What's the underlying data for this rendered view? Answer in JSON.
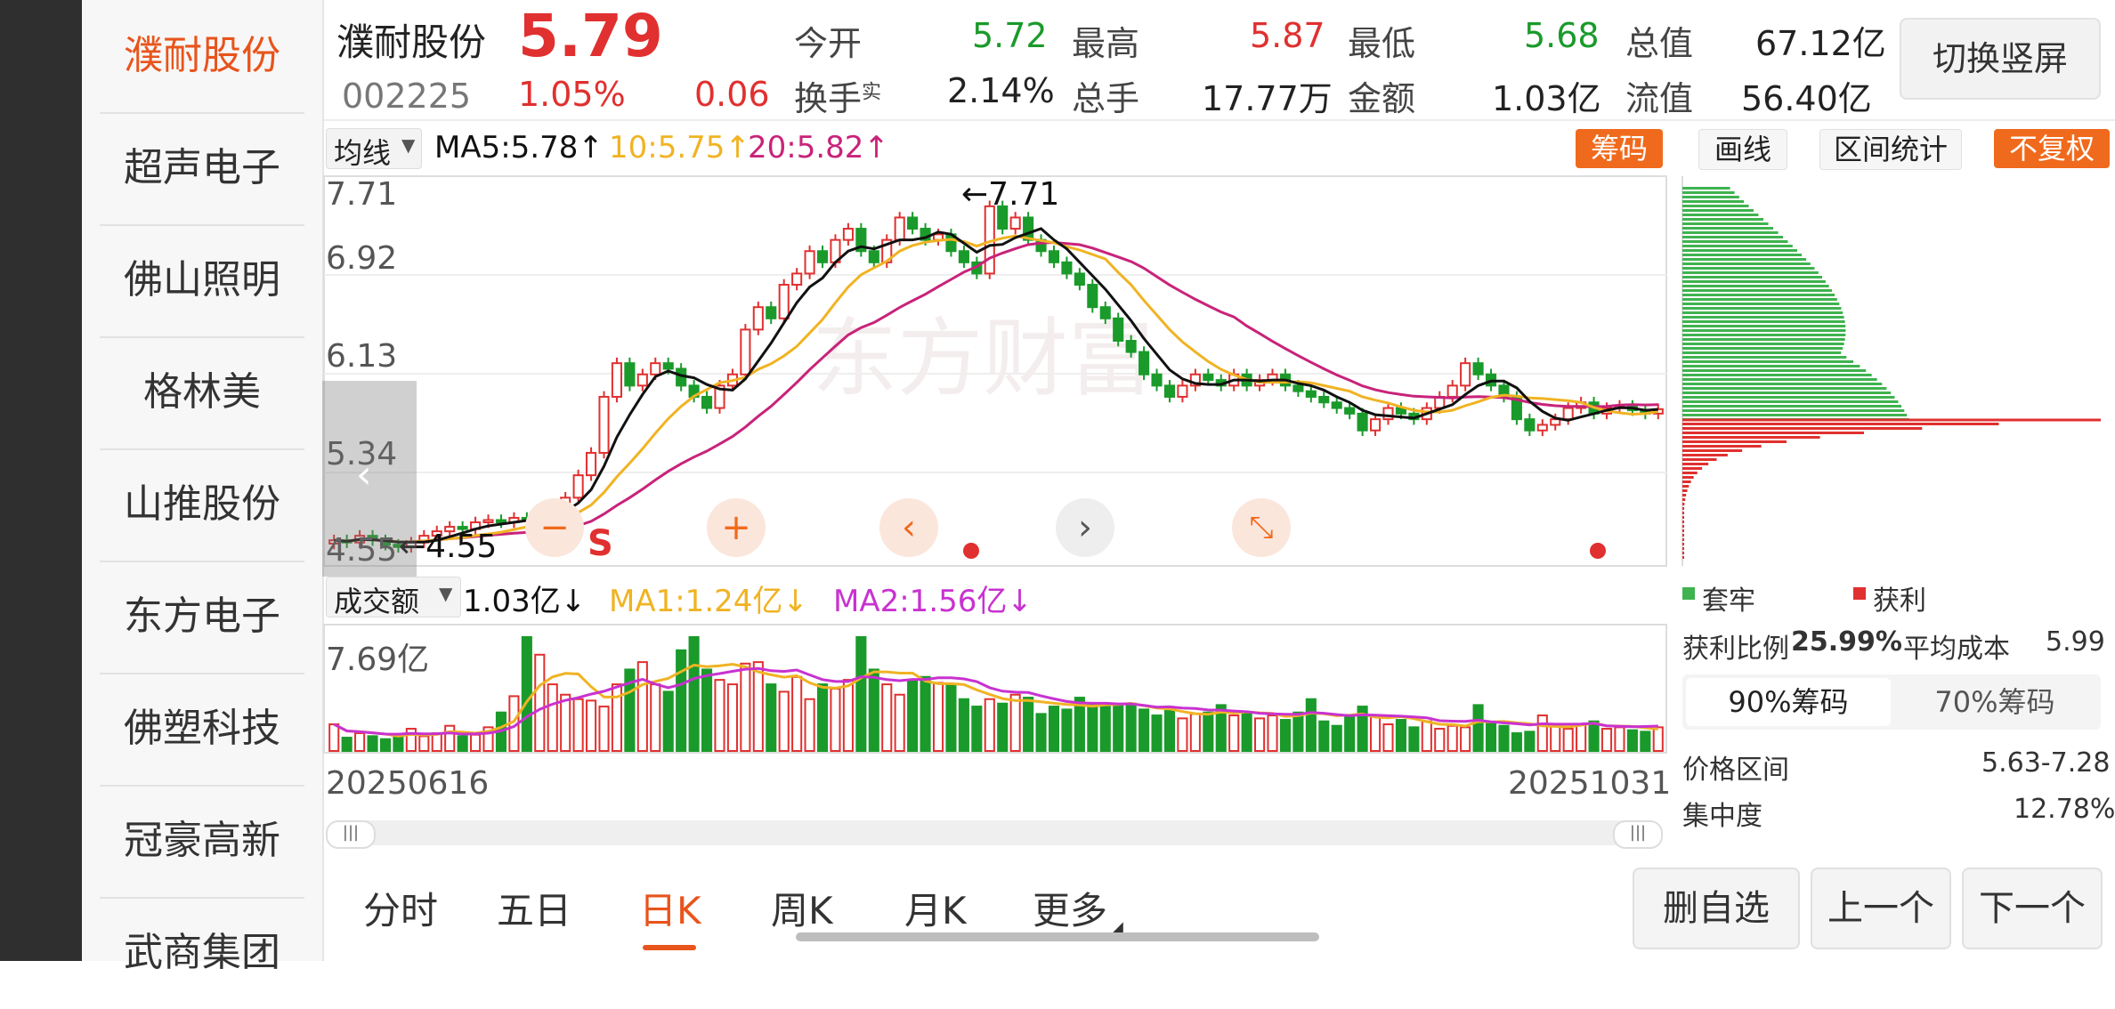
{
  "sidebar": {
    "items": [
      {
        "label": "濮耐股份",
        "active": true
      },
      {
        "label": "超声电子"
      },
      {
        "label": "佛山照明"
      },
      {
        "label": "格林美"
      },
      {
        "label": "山推股份"
      },
      {
        "label": "东方电子"
      },
      {
        "label": "佛塑科技"
      },
      {
        "label": "冠豪高新"
      },
      {
        "label": "武商集团"
      }
    ]
  },
  "quote": {
    "name": "濮耐股份",
    "price": "5.79",
    "code": "002225",
    "pct": "1.05%",
    "change": "0.06",
    "open_label": "今开",
    "open": "5.72",
    "high_label": "最高",
    "high": "5.87",
    "low_label": "最低",
    "low": "5.68",
    "mcap_label": "总值",
    "mcap": "67.12亿",
    "turnover_label": "换手",
    "turnover_sup": "实",
    "turnover": "2.14%",
    "volume_label": "总手",
    "volume": "17.77万",
    "amount_label": "金额",
    "amount": "1.03亿",
    "float_label": "流值",
    "float": "56.40亿",
    "switch_button": "切换竖屏"
  },
  "toolbar": {
    "indicator": "均线",
    "ma5": "MA5:5.78",
    "ma10": "10:5.75",
    "ma20": "20:5.82",
    "chip_button": "筹码",
    "draw_button": "画线",
    "range_button": "区间统计",
    "adjust_button": "不复权"
  },
  "colors": {
    "up": "#e0302f",
    "down": "#1a9a2a",
    "ma5": "#111111",
    "ma10": "#f0b323",
    "ma20": "#c8237a",
    "accent": "#f06a1d",
    "ma2": "#c832d0"
  },
  "chart_data": [
    {
      "type": "candlestick",
      "ylim": [
        4.55,
        7.71
      ],
      "y_ticks": [
        "7.71",
        "6.92",
        "6.13",
        "5.34",
        "4.55"
      ],
      "max_label": "7.71",
      "min_label": "4.55",
      "date_start": "20250616",
      "date_end": "20251031",
      "close": [
        4.62,
        4.6,
        4.66,
        4.62,
        4.58,
        4.56,
        4.6,
        4.66,
        4.7,
        4.74,
        4.72,
        4.78,
        4.8,
        4.78,
        4.82,
        4.8,
        4.86,
        4.9,
        5.0,
        5.2,
        5.4,
        5.9,
        6.2,
        6.0,
        6.1,
        6.2,
        6.15,
        6.0,
        5.9,
        5.8,
        6.0,
        6.1,
        6.5,
        6.7,
        6.6,
        6.9,
        7.0,
        7.2,
        7.1,
        7.3,
        7.4,
        7.2,
        7.1,
        7.3,
        7.5,
        7.4,
        7.3,
        7.35,
        7.2,
        7.1,
        7.0,
        7.6,
        7.4,
        7.5,
        7.3,
        7.2,
        7.1,
        7.0,
        6.9,
        6.7,
        6.6,
        6.4,
        6.3,
        6.1,
        6.0,
        5.9,
        6.0,
        6.1,
        6.05,
        6.0,
        6.1,
        6.0,
        6.05,
        6.1,
        6.0,
        5.95,
        5.9,
        5.85,
        5.8,
        5.75,
        5.6,
        5.7,
        5.8,
        5.75,
        5.7,
        5.8,
        5.9,
        6.0,
        6.2,
        6.1,
        6.0,
        5.9,
        5.7,
        5.6,
        5.65,
        5.7,
        5.8,
        5.85,
        5.75,
        5.8,
        5.82,
        5.78,
        5.75,
        5.79
      ]
    },
    {
      "type": "bar",
      "series_label": "成交额",
      "amount": "1.03亿",
      "ma1": "MA1:1.24亿",
      "ma2": "MA2:1.56亿",
      "y_max_label": "7.69亿",
      "values": [
        1.8,
        0.9,
        1.2,
        1.0,
        0.8,
        1.1,
        1.5,
        1.0,
        1.2,
        1.7,
        1.0,
        1.1,
        1.6,
        2.6,
        3.7,
        7.69,
        6.5,
        4.5,
        3.8,
        3.5,
        3.4,
        3.0,
        4.5,
        5.5,
        6.0,
        4.5,
        4.0,
        6.8,
        7.69,
        5.5,
        4.8,
        4.5,
        5.9,
        6.0,
        4.5,
        4.0,
        5.0,
        3.5,
        4.5,
        4.2,
        4.8,
        7.69,
        5.5,
        4.5,
        3.8,
        4.8,
        5.0,
        4.6,
        4.5,
        3.5,
        3.0,
        3.5,
        3.2,
        3.8,
        3.6,
        2.5,
        3.0,
        2.8,
        3.6,
        3.2,
        3.0,
        3.1,
        3.2,
        2.8,
        2.4,
        2.7,
        2.2,
        2.5,
        2.6,
        3.1,
        2.4,
        2.6,
        2.2,
        2.4,
        2.1,
        2.6,
        3.5,
        2.0,
        1.7,
        2.3,
        3.0,
        2.4,
        1.8,
        2.1,
        1.6,
        2.0,
        1.5,
        1.7,
        1.6,
        3.1,
        1.9,
        1.7,
        1.2,
        1.3,
        2.4,
        1.7,
        1.5,
        1.8,
        2.0,
        1.5,
        1.6,
        1.4,
        1.3,
        1.6
      ]
    }
  ],
  "chips": {
    "legend_trapped": "套牢",
    "legend_profit": "获利",
    "profit_ratio_label": "获利比例",
    "profit_ratio": "25.99%",
    "avg_cost_label": "平均成本",
    "avg_cost": "5.99",
    "tab_90": "90%筹码",
    "tab_70": "70%筹码",
    "range_label": "价格区间",
    "range": "5.63-7.28",
    "conc_label": "集中度",
    "conc": "12.78%"
  },
  "tabs": [
    "分时",
    "五日",
    "日K",
    "周K",
    "月K",
    "更多"
  ],
  "active_tab": "日K",
  "actions": {
    "remove": "删自选",
    "prev": "上一个",
    "next": "下一个"
  },
  "chart_controls": {
    "sell_marker": "S"
  }
}
